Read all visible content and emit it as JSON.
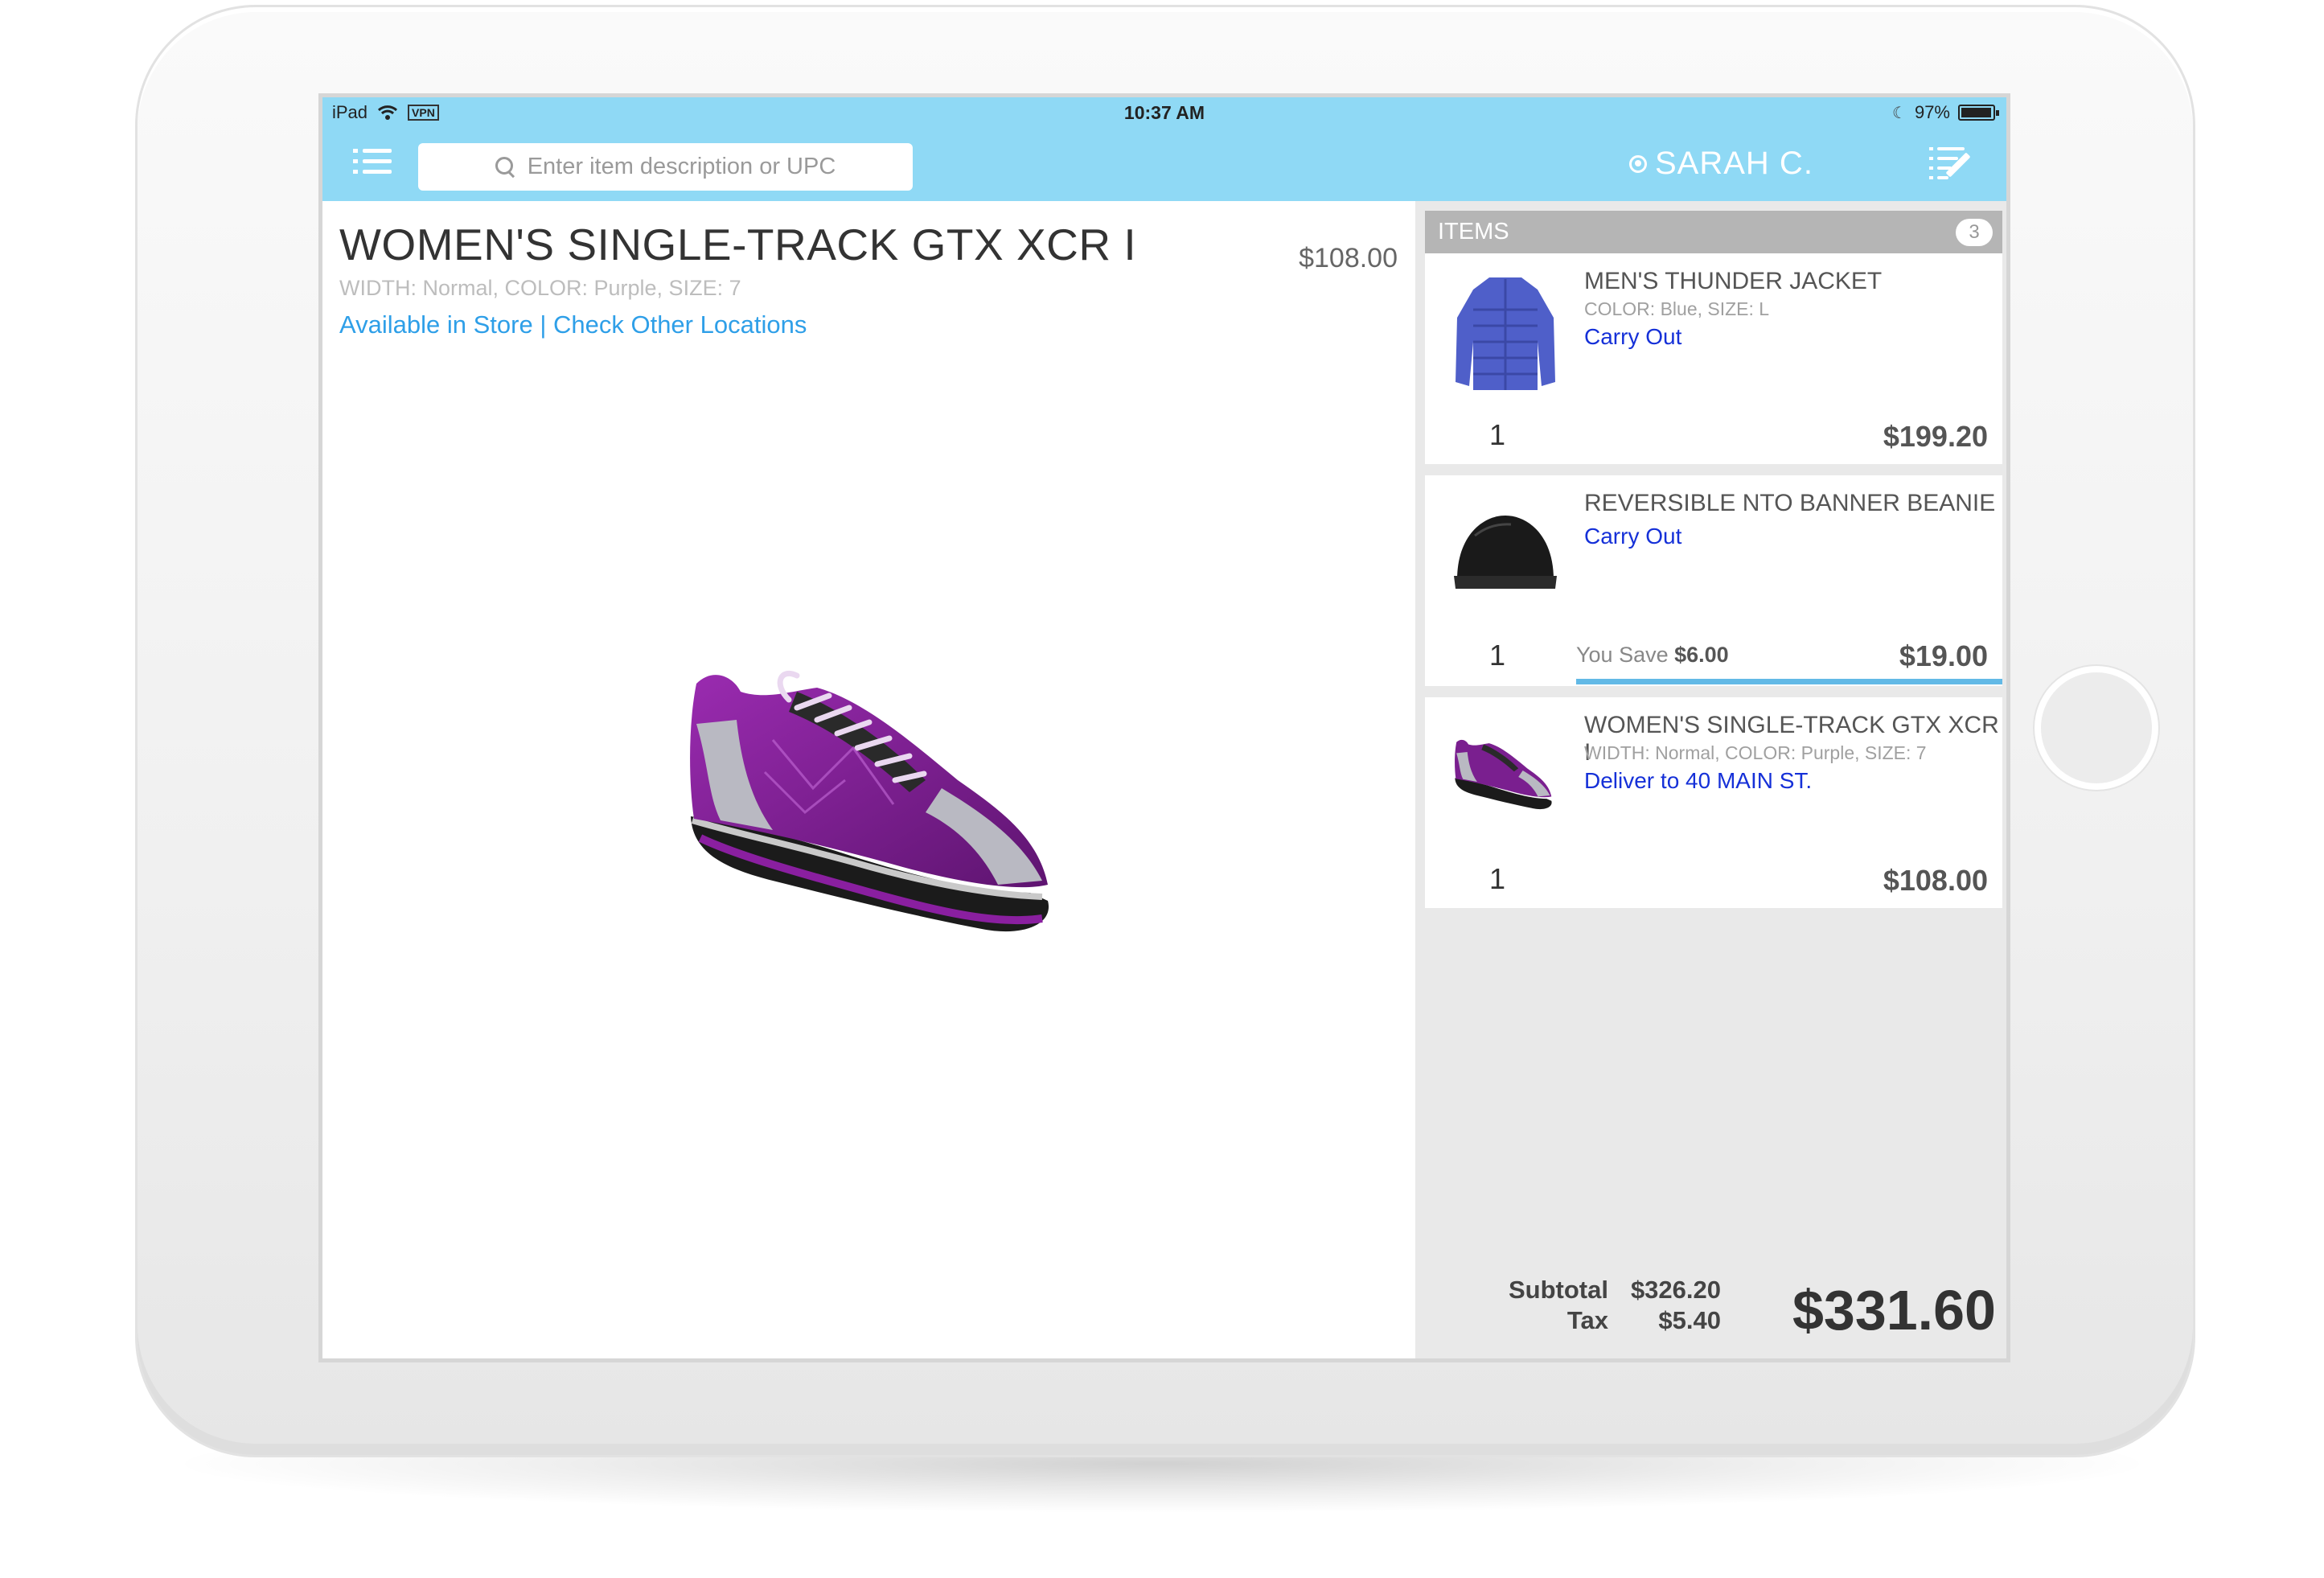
{
  "statusbar": {
    "device": "iPad",
    "vpn": "VPN",
    "time": "10:37 AM",
    "battery_text": "97%",
    "battery_level": 0.97
  },
  "navbar": {
    "search_placeholder": "Enter item description or UPC",
    "user_name": "SARAH C."
  },
  "product": {
    "title": "WOMEN'S SINGLE-TRACK GTX XCR I",
    "price": "$108.00",
    "attributes": "WIDTH: Normal, COLOR: Purple, SIZE: 7",
    "available_label": "Available in Store",
    "separator": " | ",
    "other_locations_label": "Check Other Locations",
    "image_color": "#7a1f8f"
  },
  "cart": {
    "header": "ITEMS",
    "count": "3",
    "items": [
      {
        "name": "MEN'S THUNDER JACKET",
        "attributes": "COLOR: Blue, SIZE: L",
        "fulfillment": "Carry Out",
        "qty": "1",
        "price": "$199.20",
        "image": "jacket-icon"
      },
      {
        "name": "REVERSIBLE NTO BANNER BEANIE",
        "attributes": "",
        "fulfillment": "Carry Out",
        "qty": "1",
        "savings_label": "You Save",
        "savings_value": "$6.00",
        "price": "$19.00",
        "image": "beanie-icon"
      },
      {
        "name": "WOMEN'S SINGLE-TRACK GTX XCR I",
        "attributes": "WIDTH: Normal, COLOR: Purple, SIZE: 7",
        "fulfillment": "Deliver to 40 MAIN ST.",
        "qty": "1",
        "price": "$108.00",
        "image": "shoe-icon"
      }
    ]
  },
  "totals": {
    "subtotal_label": "Subtotal",
    "subtotal_value": "$326.20",
    "tax_label": "Tax",
    "tax_value": "$5.40",
    "total": "$331.60"
  },
  "colors": {
    "header_bg": "#8fd9f5",
    "link_blue": "#2e9fe8",
    "fulfillment_blue": "#1530d8",
    "savings_bar": "#62b9e6"
  }
}
